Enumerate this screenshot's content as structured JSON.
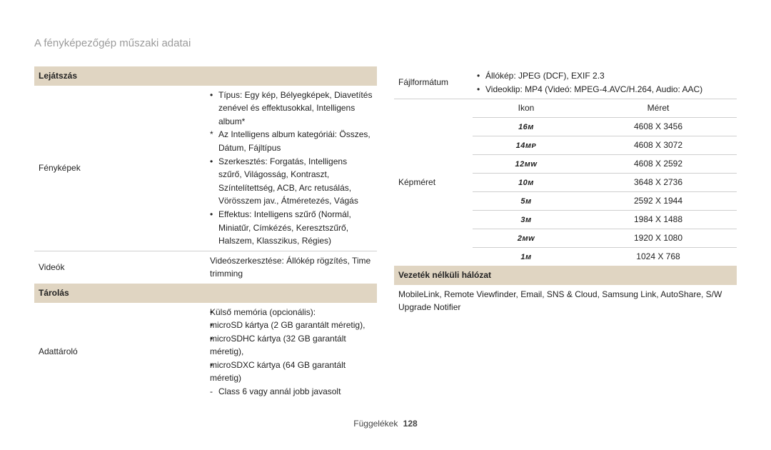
{
  "page_title": "A fényképezőgép műszaki adatai",
  "footer": {
    "label": "Függelékek",
    "page": "128"
  },
  "left": {
    "lejatszas_header": "Lejátszás",
    "fenykepek_label": "Fényképek",
    "fenykepek_items": [
      "Típus: Egy kép, Bélyegképek, Diavetítés zenével és effektusokkal, Intelligens album*",
      "Az Intelligens album kategóriái: Összes, Dátum, Fájltípus",
      "Szerkesztés: Forgatás, Intelligens szűrő, Világosság, Kontraszt, Színtelítettség, ACB, Arc retusálás, Vörösszem jav., Átméretezés, Vágás",
      "Effektus: Intelligens szűrő (Normál, Miniatűr, Címkézés, Keresztszűrő, Halszem, Klasszikus, Régies)"
    ],
    "videok_label": "Videók",
    "videok_value": "Videószerkesztése: Állókép rögzítés, Time trimming",
    "tarolas_header": "Tárolás",
    "adattarolo_label": "Adattároló",
    "adattarolo_value": "Külső memória (opcionális):\nmicroSD kártya (2 GB garantált méretig),\nmicroSDHC kártya (32 GB garantált méretig),\nmicroSDXC kártya (64 GB garantált méretig)\n- Class 6 vagy annál jobb javasolt",
    "adattarolo_lines": [
      "Külső memória (opcionális):",
      "microSD kártya (2 GB garantált méretig),",
      "microSDHC kártya (32 GB garantált méretig),",
      "microSDXC kártya (64 GB garantált méretig)",
      "Class 6 vagy annál jobb javasolt"
    ]
  },
  "right": {
    "fajlformatum_label": "Fájlformátum",
    "fajlformatum_items": [
      "Állókép: JPEG (DCF), EXIF 2.3",
      "Videoklip: MP4 (Videó: MPEG-4.AVC/H.264, Audio: AAC)"
    ],
    "kepmeret_label": "Képméret",
    "kepmeret_headers": {
      "ikon": "Ikon",
      "meret": "Méret"
    },
    "kepmeret_rows": [
      {
        "icon": "16ᴍ",
        "size": "4608 X 3456"
      },
      {
        "icon": "14ᴍᴘ",
        "size": "4608 X 3072"
      },
      {
        "icon": "12ᴍᴡ",
        "size": "4608 X 2592"
      },
      {
        "icon": "10ᴍ",
        "size": "3648 X 2736"
      },
      {
        "icon": "5ᴍ",
        "size": "2592 X 1944"
      },
      {
        "icon": "3ᴍ",
        "size": "1984 X 1488"
      },
      {
        "icon": "2ᴍᴡ",
        "size": "1920 X 1080"
      },
      {
        "icon": "1ᴍ",
        "size": "1024 X 768"
      }
    ],
    "wifi_header": "Vezeték nélküli hálózat",
    "wifi_value": "MobileLink, Remote Viewfinder, Email, SNS & Cloud, Samsung Link, AutoShare, S/W Upgrade Notifier"
  },
  "chart_data": {
    "type": "table",
    "title": "Képméret",
    "columns": [
      "Ikon",
      "Méret"
    ],
    "rows": [
      [
        "16ᴍ",
        "4608 X 3456"
      ],
      [
        "14ᴍᴘ",
        "4608 X 3072"
      ],
      [
        "12ᴍᴡ",
        "4608 X 2592"
      ],
      [
        "10ᴍ",
        "3648 X 2736"
      ],
      [
        "5ᴍ",
        "2592 X 1944"
      ],
      [
        "3ᴍ",
        "1984 X 1488"
      ],
      [
        "2ᴍᴡ",
        "1920 X 1080"
      ],
      [
        "1ᴍ",
        "1024 X 768"
      ]
    ]
  }
}
